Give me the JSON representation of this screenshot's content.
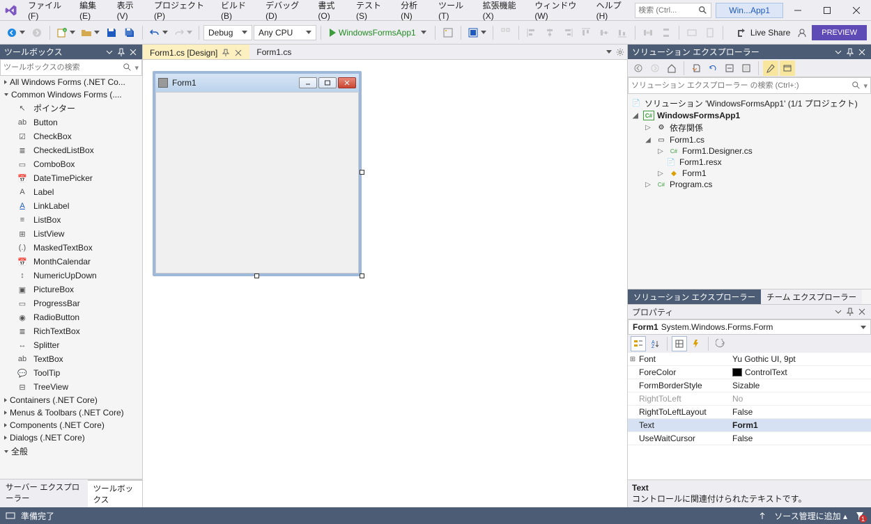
{
  "menubar": [
    "ファイル(F)",
    "編集(E)",
    "表示(V)",
    "プロジェクト(P)",
    "ビルド(B)",
    "デバッグ(D)",
    "書式(O)",
    "テスト(S)",
    "分析(N)",
    "ツール(T)",
    "拡張機能(X)",
    "ウィンドウ(W)",
    "ヘルプ(H)"
  ],
  "title_search_placeholder": "検索 (Ctrl...",
  "title_doc": "Win...App1",
  "toolbar": {
    "config": "Debug",
    "platform": "Any CPU",
    "run_target": "WindowsFormsApp1",
    "live_share": "Live Share",
    "preview": "PREVIEW"
  },
  "toolbox": {
    "title": "ツールボックス",
    "search_placeholder": "ツールボックスの検索",
    "cat_all": "All Windows Forms (.NET Co...",
    "cat_common": "Common Windows Forms (....",
    "items": [
      {
        "icon": "↖",
        "label": "ポインター"
      },
      {
        "icon": "ab",
        "label": "Button"
      },
      {
        "icon": "☑",
        "label": "CheckBox"
      },
      {
        "icon": "≣",
        "label": "CheckedListBox"
      },
      {
        "icon": "▭",
        "label": "ComboBox"
      },
      {
        "icon": "📅",
        "label": "DateTimePicker"
      },
      {
        "icon": "A",
        "label": "Label"
      },
      {
        "icon": "A",
        "label": "LinkLabel"
      },
      {
        "icon": "≡",
        "label": "ListBox"
      },
      {
        "icon": "⊞",
        "label": "ListView"
      },
      {
        "icon": "(.)",
        "label": "MaskedTextBox"
      },
      {
        "icon": "📅",
        "label": "MonthCalendar"
      },
      {
        "icon": "↕",
        "label": "NumericUpDown"
      },
      {
        "icon": "▣",
        "label": "PictureBox"
      },
      {
        "icon": "▭",
        "label": "ProgressBar"
      },
      {
        "icon": "◉",
        "label": "RadioButton"
      },
      {
        "icon": "≣",
        "label": "RichTextBox"
      },
      {
        "icon": "↔",
        "label": "Splitter"
      },
      {
        "icon": "ab",
        "label": "TextBox"
      },
      {
        "icon": "💬",
        "label": "ToolTip"
      },
      {
        "icon": "⊟",
        "label": "TreeView"
      }
    ],
    "cat_containers": "Containers (.NET Core)",
    "cat_menus": "Menus & Toolbars (.NET Core)",
    "cat_components": "Components (.NET Core)",
    "cat_dialogs": "Dialogs (.NET Core)",
    "cat_general": "全般",
    "tab_server": "サーバー エクスプローラー",
    "tab_toolbox": "ツールボックス"
  },
  "doc_tabs": {
    "active": "Form1.cs [Design]",
    "other": "Form1.cs"
  },
  "winform": {
    "title": "Form1"
  },
  "explorer": {
    "title": "ソリューション エクスプローラー",
    "search_placeholder": "ソリューション エクスプローラー の検索 (Ctrl+:)",
    "solution": "ソリューション 'WindowsFormsApp1' (1/1 プロジェクト)",
    "project": "WindowsFormsApp1",
    "deps": "依存関係",
    "form1cs": "Form1.cs",
    "form1des": "Form1.Designer.cs",
    "form1resx": "Form1.resx",
    "form1class": "Form1",
    "programcs": "Program.cs",
    "tab_sol": "ソリューション エクスプローラー",
    "tab_team": "チーム エクスプローラー"
  },
  "props": {
    "title": "プロパティ",
    "obj_name": "Form1",
    "obj_type": "System.Windows.Forms.Form",
    "rows": [
      {
        "exp": "⊞",
        "name": "Font",
        "val": "Yu Gothic UI, 9pt"
      },
      {
        "exp": "",
        "name": "ForeColor",
        "val": "ControlText",
        "color": "#000"
      },
      {
        "exp": "",
        "name": "FormBorderStyle",
        "val": "Sizable"
      },
      {
        "exp": "",
        "name": "RightToLeft",
        "val": "No",
        "grey": true
      },
      {
        "exp": "",
        "name": "RightToLeftLayout",
        "val": "False"
      },
      {
        "exp": "",
        "name": "Text",
        "val": "Form1",
        "bold": true,
        "selected": true
      },
      {
        "exp": "",
        "name": "UseWaitCursor",
        "val": "False"
      }
    ],
    "desc_title": "Text",
    "desc_body": "コントロールに関連付けられたテキストです。"
  },
  "statusbar": {
    "ready": "準備完了",
    "src_ctrl": "ソース管理に追加"
  }
}
